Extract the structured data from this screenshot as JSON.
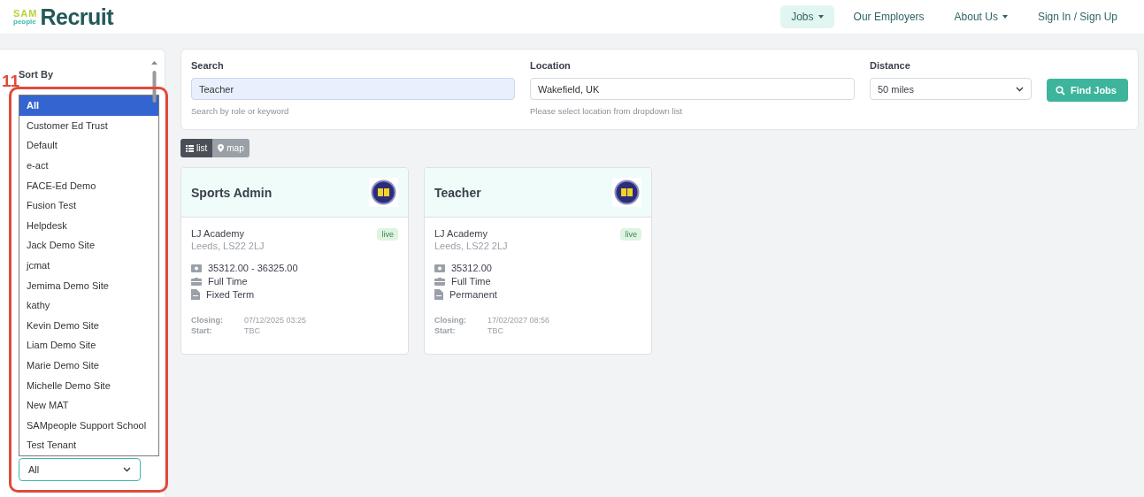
{
  "logo": {
    "mark_top": "SAM",
    "mark_bottom": "people",
    "name": "Recruit"
  },
  "nav": [
    {
      "label": "Jobs",
      "kind": "dropdown",
      "selected": true
    },
    {
      "label": "Our Employers",
      "kind": "link",
      "selected": false
    },
    {
      "label": "About Us",
      "kind": "dropdown",
      "selected": false
    },
    {
      "label": "Sign In / Sign Up",
      "kind": "link",
      "selected": false
    }
  ],
  "sidebar": {
    "label": "Sort By",
    "annotation": "11",
    "options": [
      {
        "label": "All",
        "selected": true
      },
      {
        "label": "Customer Ed Trust",
        "selected": false
      },
      {
        "label": "Default",
        "selected": false
      },
      {
        "label": "e-act",
        "selected": false
      },
      {
        "label": "FACE-Ed Demo",
        "selected": false
      },
      {
        "label": "Fusion Test",
        "selected": false
      },
      {
        "label": "Helpdesk",
        "selected": false
      },
      {
        "label": "Jack Demo Site",
        "selected": false
      },
      {
        "label": "jcmat",
        "selected": false
      },
      {
        "label": "Jemima Demo Site",
        "selected": false
      },
      {
        "label": "kathy",
        "selected": false
      },
      {
        "label": "Kevin Demo Site",
        "selected": false
      },
      {
        "label": "Liam Demo Site",
        "selected": false
      },
      {
        "label": "Marie Demo Site",
        "selected": false
      },
      {
        "label": "Michelle Demo Site",
        "selected": false
      },
      {
        "label": "New MAT",
        "selected": false
      },
      {
        "label": "SAMpeople Support School",
        "selected": false
      },
      {
        "label": "Test Tenant",
        "selected": false
      }
    ],
    "select": {
      "value": "All"
    }
  },
  "search": {
    "fields": [
      {
        "label": "Search",
        "kind": "text",
        "value": "Teacher",
        "hint": "Search by role or keyword",
        "focused": true
      },
      {
        "label": "Location",
        "kind": "text",
        "value": "Wakefield, UK",
        "hint": "Please select location from dropdown list",
        "focused": false
      },
      {
        "label": "Distance",
        "kind": "select",
        "value": "50 miles"
      }
    ],
    "button": "Find Jobs"
  },
  "view_toggle": [
    {
      "label": "list",
      "kind": "list",
      "selected": true
    },
    {
      "label": "map",
      "kind": "map",
      "selected": false
    }
  ],
  "jobs": [
    {
      "title": "Sports Admin",
      "employer": "LJ Academy",
      "location": "Leeds, LS22 2LJ",
      "status": "live",
      "salary": "35312.00 - 36325.00",
      "hours": "Full Time",
      "contract": "Fixed Term",
      "closing_label": "Closing:",
      "closing": "07/12/2025 03:25",
      "start_label": "Start:",
      "start": "TBC"
    },
    {
      "title": "Teacher",
      "employer": "LJ Academy",
      "location": "Leeds, LS22 2LJ",
      "status": "live",
      "salary": "35312.00",
      "hours": "Full Time",
      "contract": "Permanent",
      "closing_label": "Closing:",
      "closing": "17/02/2027 08:56",
      "start_label": "Start:",
      "start": "TBC"
    }
  ]
}
